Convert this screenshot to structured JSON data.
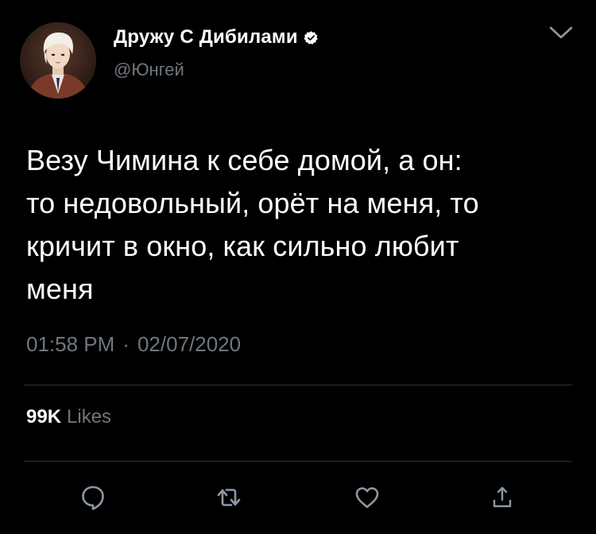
{
  "tweet": {
    "display_name": "Дружу С Дибилами",
    "handle": "@Юнгей",
    "text": "Везу Чимина к себе домой, а он:\nто недовольный, орёт на меня, то\nкричит в окно, как сильно любит\nменя",
    "time": "01:58 PM",
    "separator": "·",
    "date": "02/07/2020",
    "likes_count": "99K",
    "likes_label": "Likes"
  },
  "icons": {
    "verified": "verified-badge-icon",
    "menu": "chevron-down-icon",
    "reply": "reply-bubble-icon",
    "retweet": "retweet-icon",
    "like": "heart-icon",
    "share": "share-icon"
  },
  "colors": {
    "background": "#000000",
    "primary_text": "#ffffff",
    "secondary_text": "#6f767d",
    "divider": "#2f3336",
    "icon": "#8b98a5"
  }
}
